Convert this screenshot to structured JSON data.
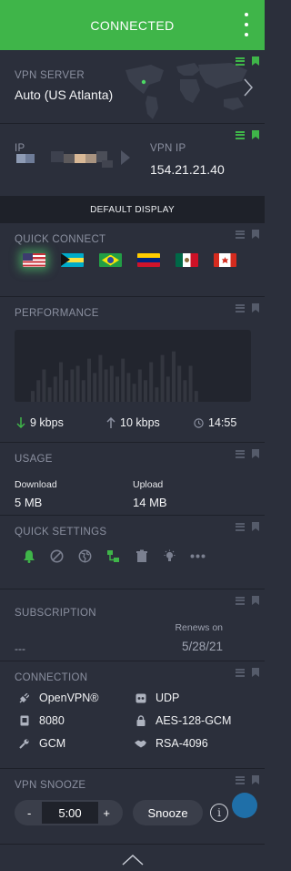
{
  "header": {
    "status": "CONNECTED"
  },
  "server": {
    "label": "VPN SERVER",
    "value": "Auto (US Atlanta)"
  },
  "ip": {
    "label": "IP",
    "vpn_label": "VPN IP",
    "vpn_value": "154.21.21.40"
  },
  "display_bar": {
    "label": "DEFAULT DISPLAY"
  },
  "quick_connect": {
    "label": "QUICK CONNECT",
    "flags": [
      "us-flag",
      "bahamas-flag",
      "brazil-flag",
      "venezuela-flag",
      "mexico-flag",
      "canada-flag"
    ],
    "selected": "us-flag"
  },
  "performance": {
    "label": "PERFORMANCE",
    "download": "9 kbps",
    "upload": "10 kbps",
    "time": "14:55",
    "bars": [
      0.15,
      0.3,
      0.45,
      0.2,
      0.35,
      0.55,
      0.3,
      0.45,
      0.5,
      0.3,
      0.6,
      0.4,
      0.65,
      0.45,
      0.5,
      0.35,
      0.6,
      0.4,
      0.25,
      0.45,
      0.3,
      0.55,
      0.2,
      0.65,
      0.35,
      0.7,
      0.5,
      0.3,
      0.5,
      0.15
    ]
  },
  "usage": {
    "label": "USAGE",
    "download_label": "Download",
    "download_value": "5 MB",
    "upload_label": "Upload",
    "upload_value": "14 MB"
  },
  "quick_settings": {
    "label": "QUICK SETTINGS",
    "icons": [
      "bell-icon",
      "blocker-icon",
      "globe-icon",
      "network-icon",
      "trash-icon",
      "lightbulb-icon",
      "more-icon"
    ]
  },
  "subscription": {
    "label": "SUBSCRIPTION",
    "value": "---",
    "renews_label": "Renews on",
    "renews_value": "5/28/21"
  },
  "connection": {
    "label": "CONNECTION",
    "protocol": "OpenVPN®",
    "transport": "UDP",
    "port": "8080",
    "encryption": "AES-128-GCM",
    "auth": "GCM",
    "handshake": "RSA-4096"
  },
  "snooze": {
    "label": "VPN SNOOZE",
    "minus": "-",
    "time": "5:00",
    "plus": "+",
    "button": "Snooze",
    "info": "i"
  },
  "colors": {
    "accent": "#3fb549",
    "background": "#2b2f3b",
    "divider": "#1d2029"
  }
}
